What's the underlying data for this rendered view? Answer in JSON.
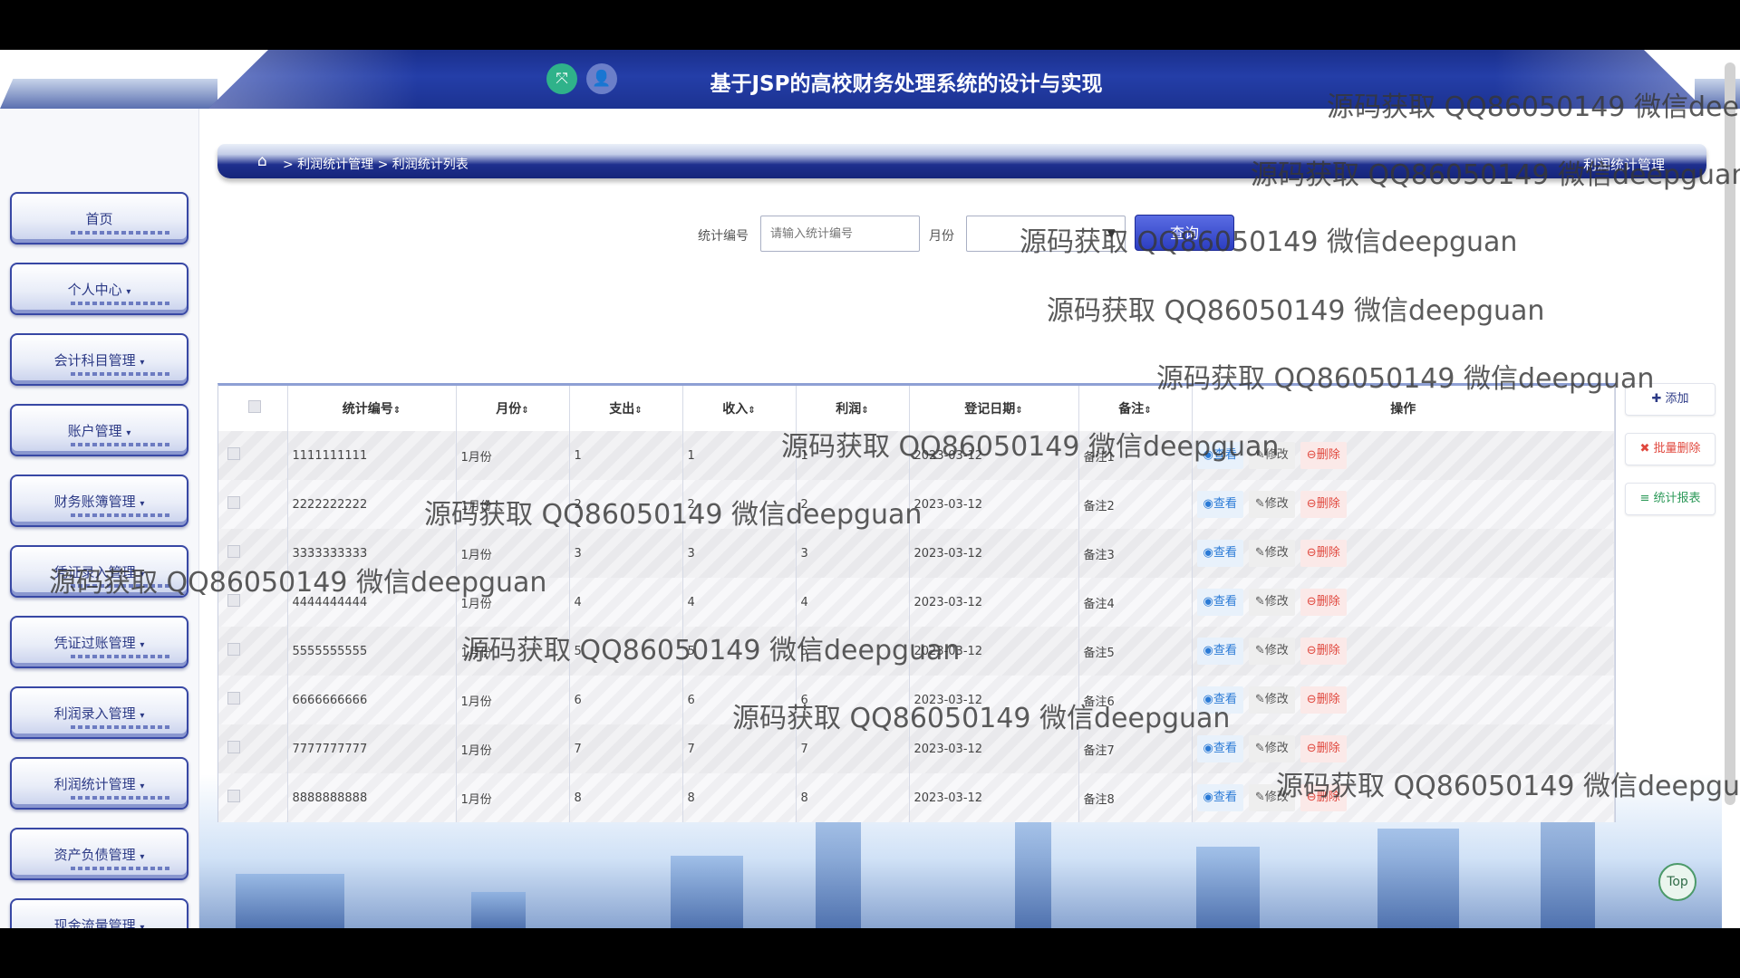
{
  "header": {
    "title": "基于JSP的高校财务处理系统的设计与实现",
    "icons": [
      "fullscreen-icon",
      "user-icon"
    ]
  },
  "sidebar": {
    "items": [
      {
        "label": "首页",
        "caret": ""
      },
      {
        "label": "个人中心",
        "caret": "▾"
      },
      {
        "label": "会计科目管理",
        "caret": "▾"
      },
      {
        "label": "账户管理",
        "caret": "▾"
      },
      {
        "label": "财务账簿管理",
        "caret": "▾"
      },
      {
        "label": "凭证录入管理",
        "caret": "▾"
      },
      {
        "label": "凭证过账管理",
        "caret": "▾"
      },
      {
        "label": "利润录入管理",
        "caret": "▾"
      },
      {
        "label": "利润统计管理",
        "caret": "▾"
      },
      {
        "label": "资产负债管理",
        "caret": "▾"
      },
      {
        "label": "现金流量管理",
        "caret": "▾"
      }
    ]
  },
  "breadcrumb": {
    "path": "> 利润统计管理 > 利润统计列表",
    "current": "利润统计管理"
  },
  "search": {
    "code_label": "统计编号",
    "code_placeholder": "请输入统计编号",
    "month_label": "月份",
    "month_value": "",
    "query_label": "查询"
  },
  "actions": {
    "add": "添加",
    "batch_delete": "批量删除",
    "report": "统计报表"
  },
  "table": {
    "headers": [
      "统计编号",
      "月份",
      "支出",
      "收入",
      "利润",
      "登记日期",
      "备注",
      "操作"
    ],
    "sort_glyph": "⇕",
    "op_labels": {
      "view": "查看",
      "edit": "修改",
      "delete": "删除"
    },
    "rows": [
      {
        "code": "1111111111",
        "month": "1月份",
        "expense": "1",
        "income": "1",
        "profit": "1",
        "date": "2023-03-12",
        "note": "备注1"
      },
      {
        "code": "2222222222",
        "month": "1月份",
        "expense": "2",
        "income": "2",
        "profit": "2",
        "date": "2023-03-12",
        "note": "备注2"
      },
      {
        "code": "3333333333",
        "month": "1月份",
        "expense": "3",
        "income": "3",
        "profit": "3",
        "date": "2023-03-12",
        "note": "备注3"
      },
      {
        "code": "4444444444",
        "month": "1月份",
        "expense": "4",
        "income": "4",
        "profit": "4",
        "date": "2023-03-12",
        "note": "备注4"
      },
      {
        "code": "5555555555",
        "month": "1月份",
        "expense": "5",
        "income": "5",
        "profit": "5",
        "date": "2023-03-12",
        "note": "备注5"
      },
      {
        "code": "6666666666",
        "month": "1月份",
        "expense": "6",
        "income": "6",
        "profit": "6",
        "date": "2023-03-12",
        "note": "备注6"
      },
      {
        "code": "7777777777",
        "month": "1月份",
        "expense": "7",
        "income": "7",
        "profit": "7",
        "date": "2023-03-12",
        "note": "备注7"
      },
      {
        "code": "8888888888",
        "month": "1月份",
        "expense": "8",
        "income": "8",
        "profit": "8",
        "date": "2023-03-12",
        "note": "备注8"
      }
    ]
  },
  "top_button": "Top",
  "watermark": "源码获取 QQ86050149 微信deepguan",
  "colors": {
    "header_blue": "#1f3494",
    "query_button": "#3446c8",
    "delete_red": "#e0473d",
    "view_blue": "#2a7ad6",
    "report_green": "#2e9a5a"
  }
}
